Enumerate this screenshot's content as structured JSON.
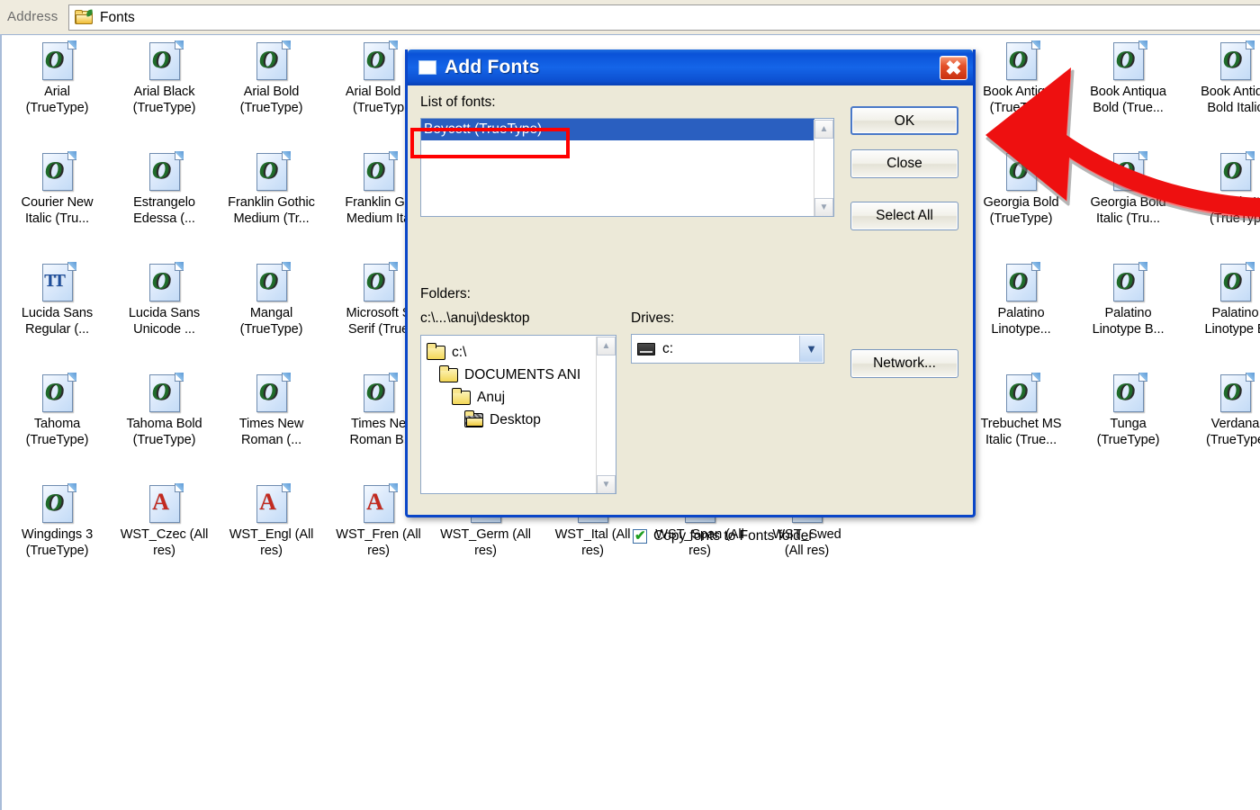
{
  "addressbar": {
    "label": "Address",
    "value": "Fonts",
    "icon": "folder-icon"
  },
  "explorer": {
    "fonts": [
      {
        "name": "Arial\n(TrueType)",
        "glyph": "O",
        "kind": "truetype",
        "col": 0,
        "row": 0
      },
      {
        "name": "Arial Black\n(TrueType)",
        "glyph": "O",
        "kind": "truetype",
        "col": 1,
        "row": 0
      },
      {
        "name": "Arial Bold\n(TrueType)",
        "glyph": "O",
        "kind": "truetype",
        "col": 2,
        "row": 0
      },
      {
        "name": "Arial Bold It\n(TrueTyp",
        "glyph": "O",
        "kind": "truetype",
        "col": 3,
        "row": 0
      },
      {
        "name": "Book Antiqua\n(TrueType)",
        "glyph": "O",
        "kind": "truetype",
        "col": 9,
        "row": 0
      },
      {
        "name": "Book Antiqua\nBold (True...",
        "glyph": "O",
        "kind": "truetype",
        "col": 10,
        "row": 0
      },
      {
        "name": "Book Antiqu\nBold Italic",
        "glyph": "O",
        "kind": "truetype",
        "col": 11,
        "row": 0
      },
      {
        "name": "Courier New\nItalic (Tru...",
        "glyph": "O",
        "kind": "truetype",
        "col": 0,
        "row": 1
      },
      {
        "name": "Estrangelo\nEdessa (...",
        "glyph": "O",
        "kind": "truetype",
        "col": 1,
        "row": 1
      },
      {
        "name": "Franklin Gothic\nMedium (Tr...",
        "glyph": "O",
        "kind": "truetype",
        "col": 2,
        "row": 1
      },
      {
        "name": "Franklin Go\nMedium Ita",
        "glyph": "O",
        "kind": "truetype",
        "col": 3,
        "row": 1
      },
      {
        "name": "Georgia Bold\n(TrueType)",
        "glyph": "O",
        "kind": "truetype",
        "col": 9,
        "row": 1
      },
      {
        "name": "Georgia Bold\nItalic (Tru...",
        "glyph": "O",
        "kind": "truetype",
        "col": 10,
        "row": 1
      },
      {
        "name": "Georgia Ita\n(TrueTyp",
        "glyph": "O",
        "kind": "truetype",
        "col": 11,
        "row": 1
      },
      {
        "name": "Lucida Sans\nRegular (...",
        "glyph": "TT",
        "kind": "tt",
        "col": 0,
        "row": 2
      },
      {
        "name": "Lucida Sans\nUnicode ...",
        "glyph": "O",
        "kind": "truetype",
        "col": 1,
        "row": 2
      },
      {
        "name": "Mangal\n(TrueType)",
        "glyph": "O",
        "kind": "truetype",
        "col": 2,
        "row": 2
      },
      {
        "name": "Microsoft S\nSerif (True",
        "glyph": "O",
        "kind": "truetype",
        "col": 3,
        "row": 2
      },
      {
        "name": "Palatino\nLinotype...",
        "glyph": "O",
        "kind": "truetype",
        "col": 9,
        "row": 2
      },
      {
        "name": "Palatino\nLinotype B...",
        "glyph": "O",
        "kind": "truetype",
        "col": 10,
        "row": 2
      },
      {
        "name": "Palatino\nLinotype B",
        "glyph": "O",
        "kind": "truetype",
        "col": 11,
        "row": 2
      },
      {
        "name": "Tahoma\n(TrueType)",
        "glyph": "O",
        "kind": "truetype",
        "col": 0,
        "row": 3
      },
      {
        "name": "Tahoma Bold\n(TrueType)",
        "glyph": "O",
        "kind": "truetype",
        "col": 1,
        "row": 3
      },
      {
        "name": "Times New\nRoman (...",
        "glyph": "O",
        "kind": "truetype",
        "col": 2,
        "row": 3
      },
      {
        "name": "Times Ne\nRoman B.",
        "glyph": "O",
        "kind": "truetype",
        "col": 3,
        "row": 3
      },
      {
        "name": "Trebuchet MS\nItalic (True...",
        "glyph": "O",
        "kind": "truetype",
        "col": 9,
        "row": 3
      },
      {
        "name": "Tunga\n(TrueType)",
        "glyph": "O",
        "kind": "truetype",
        "col": 10,
        "row": 3
      },
      {
        "name": "Verdana\n(TrueType",
        "glyph": "O",
        "kind": "truetype",
        "col": 11,
        "row": 3
      },
      {
        "name": "Wingdings 3\n(TrueType)",
        "glyph": "O",
        "kind": "truetype",
        "col": 0,
        "row": 4
      },
      {
        "name": "WST_Czec (All\nres)",
        "glyph": "A",
        "kind": "allres",
        "col": 1,
        "row": 4
      },
      {
        "name": "WST_Engl (All\nres)",
        "glyph": "A",
        "kind": "allres",
        "col": 2,
        "row": 4
      },
      {
        "name": "WST_Fren (All\nres)",
        "glyph": "A",
        "kind": "allres",
        "col": 3,
        "row": 4
      },
      {
        "name": "WST_Germ (All\nres)",
        "glyph": "A",
        "kind": "allres",
        "col": 4,
        "row": 4
      },
      {
        "name": "WST_Ital (All\nres)",
        "glyph": "A",
        "kind": "allres",
        "col": 5,
        "row": 4
      },
      {
        "name": "WST_Span (All\nres)",
        "glyph": "A",
        "kind": "allres",
        "col": 6,
        "row": 4
      },
      {
        "name": "WST_Swed\n(All res)",
        "glyph": "A",
        "kind": "allres",
        "col": 7,
        "row": 4
      }
    ]
  },
  "dialog": {
    "title": "Add Fonts",
    "title_icon": "window-icon",
    "close_icon": "close-icon",
    "list_label": "List of fonts:",
    "font_list": [
      {
        "label": "Boycott (TrueType)",
        "selected": true
      }
    ],
    "buttons": {
      "ok": "OK",
      "close": "Close",
      "select_all": "Select All",
      "network": "Network..."
    },
    "folders_label": "Folders:",
    "current_path": "c:\\...\\anuj\\desktop",
    "folder_tree": [
      {
        "label": "c:\\",
        "indent": 0,
        "state": "closed"
      },
      {
        "label": "DOCUMENTS ANI",
        "indent": 1,
        "state": "closed"
      },
      {
        "label": "Anuj",
        "indent": 2,
        "state": "closed"
      },
      {
        "label": "Desktop",
        "indent": 3,
        "state": "open"
      }
    ],
    "drives_label": "Drives:",
    "drive_value": "c:",
    "drive_icon": "harddrive-icon",
    "copy_checkbox_label": "Copy fonts to Fonts folder",
    "copy_checkbox_checked": true
  },
  "annotations": {
    "highlight_color": "#ff0000",
    "arrow_color": "#ee0000",
    "arrow_target": "OK",
    "rect_target": "Boycott (TrueType)"
  }
}
